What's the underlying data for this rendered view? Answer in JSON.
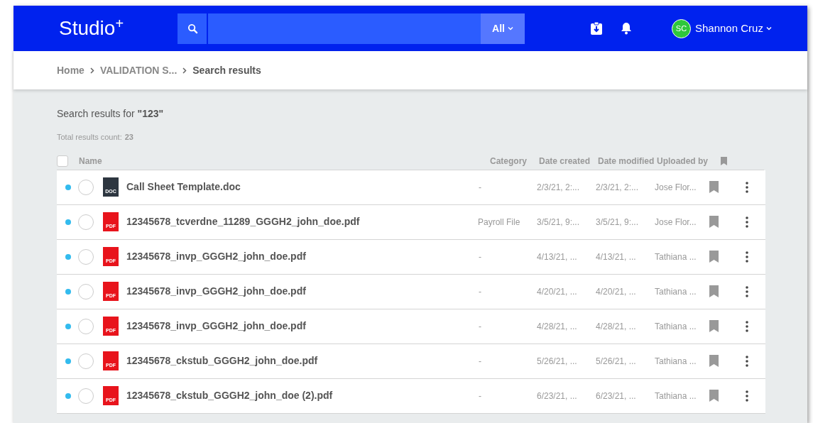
{
  "header": {
    "logo": "Studio",
    "logo_mark": "+",
    "scope": "All",
    "user": {
      "initials": "SC",
      "name": "Shannon Cruz"
    }
  },
  "breadcrumb": [
    "Home",
    "VALIDATION S...",
    "Search results"
  ],
  "results": {
    "heading": "Search results for **\"123\"**",
    "count_label": "Total results count:",
    "count": "23"
  },
  "table": {
    "select_all": {
      "checked": false
    },
    "columns": [
      "Name",
      "Category",
      "Date created",
      "Date modified",
      "Uploaded by"
    ],
    "rows": [
      {
        "unread": true,
        "selected": false,
        "kind": "doc",
        "badge": "DOC",
        "name": "Call Sheet Template.doc",
        "category": "-",
        "created": "2/3/21, 2:...",
        "modified": "2/3/21, 2:...",
        "uploaded_by": "Jose Flor...",
        "bookmarked": false
      },
      {
        "unread": true,
        "selected": false,
        "kind": "pdf",
        "badge": "PDF",
        "name": "12345678_tcverdne_11289_GGGH2_john_doe.pdf",
        "category": "Payroll File",
        "created": "3/5/21, 9:...",
        "modified": "3/5/21, 9:...",
        "uploaded_by": "Jose Flor...",
        "bookmarked": false
      },
      {
        "unread": true,
        "selected": false,
        "kind": "pdf",
        "badge": "PDF",
        "name": "12345678_invp_GGGH2_john_doe.pdf",
        "category": "-",
        "created": "4/13/21, ...",
        "modified": "4/13/21, ...",
        "uploaded_by": "Tathiana ...",
        "bookmarked": false
      },
      {
        "unread": true,
        "selected": false,
        "kind": "pdf",
        "badge": "PDF",
        "name": "12345678_invp_GGGH2_john_doe.pdf",
        "category": "-",
        "created": "4/20/21, ...",
        "modified": "4/20/21, ...",
        "uploaded_by": "Tathiana ...",
        "bookmarked": false
      },
      {
        "unread": true,
        "selected": false,
        "kind": "pdf",
        "badge": "PDF",
        "name": "12345678_invp_GGGH2_john_doe.pdf",
        "category": "-",
        "created": "4/28/21, ...",
        "modified": "4/28/21, ...",
        "uploaded_by": "Tathiana ...",
        "bookmarked": false
      },
      {
        "unread": true,
        "selected": false,
        "kind": "pdf",
        "badge": "PDF",
        "name": "12345678_ckstub_GGGH2_john_doe.pdf",
        "category": "-",
        "created": "5/26/21, ...",
        "modified": "5/26/21, ...",
        "uploaded_by": "Tathiana ...",
        "bookmarked": false
      },
      {
        "unread": true,
        "selected": false,
        "kind": "pdf",
        "badge": "PDF",
        "name": "12345678_ckstub_GGGH2_john_doe (2).pdf",
        "category": "-",
        "created": "6/23/21, ...",
        "modified": "6/23/21, ...",
        "uploaded_by": "Tathiana ...",
        "bookmarked": false
      }
    ]
  }
}
